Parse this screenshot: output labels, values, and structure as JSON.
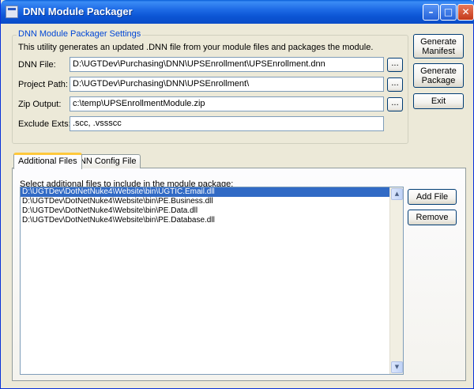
{
  "window": {
    "title": "DNN Module Packager",
    "controls": {
      "minimize": "–",
      "maximize": "□",
      "close": "✕"
    }
  },
  "settings": {
    "group_title": "DNN Module Packager Settings",
    "description": "This utility generates an updated .DNN file from your module files and packages the module.",
    "dnn_file": {
      "label": "DNN File:",
      "value": "D:\\UGTDev\\Purchasing\\DNN\\UPSEnrollment\\UPSEnrollment.dnn",
      "browse": "..."
    },
    "project_path": {
      "label": "Project Path:",
      "value": "D:\\UGTDev\\Purchasing\\DNN\\UPSEnrollment\\",
      "browse": "..."
    },
    "zip_output": {
      "label": "Zip Output:",
      "value": "c:\\temp\\UPSEnrollmentModule.zip",
      "browse": "..."
    },
    "exclude_exts": {
      "label": "Exclude Exts:",
      "value": ".scc, .vssscc"
    }
  },
  "actions": {
    "generate_manifest": "Generate Manifest",
    "generate_package": "Generate Package",
    "exit": "Exit"
  },
  "tabs": [
    {
      "label": "Additional Files",
      "active": true
    },
    {
      "label": "DNN Config File",
      "active": false
    }
  ],
  "additional_files": {
    "instruction": "Select additional files to include in the module package:",
    "files": [
      "D:\\UGTDev\\DotNetNuke4\\Website\\bin\\UGTIC.Email.dll",
      "D:\\UGTDev\\DotNetNuke4\\Website\\bin\\PE.Business.dll",
      "D:\\UGTDev\\DotNetNuke4\\Website\\bin\\PE.Data.dll",
      "D:\\UGTDev\\DotNetNuke4\\Website\\bin\\PE.Database.dll"
    ],
    "selected_index": 0,
    "add_file": "Add File",
    "remove": "Remove"
  },
  "colors": {
    "title_bar": "#0a54d4",
    "selection": "#316ac5",
    "group_title": "#0046d5",
    "active_tab_accent": "#ffc83c"
  }
}
